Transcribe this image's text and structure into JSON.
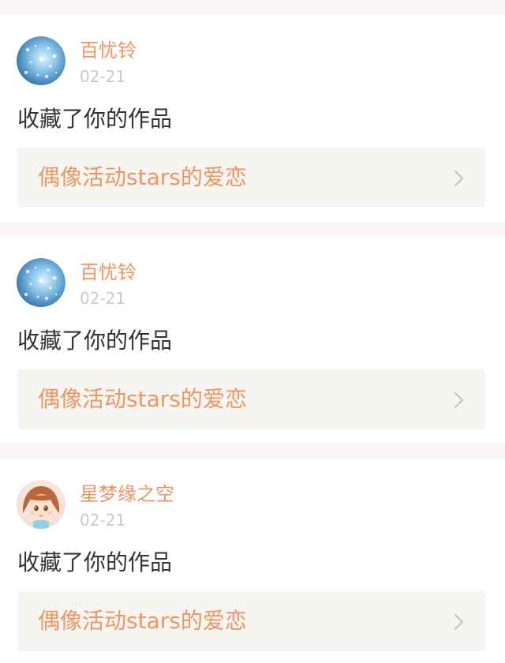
{
  "notifications": [
    {
      "avatar_icon": "blue-glitter-avatar",
      "user_name": "百忧铃",
      "timestamp": "02-21",
      "action": "收藏了你的作品",
      "work_title": "偶像活动stars的爱恋",
      "chevron_icon": "chevron-right-icon"
    },
    {
      "avatar_icon": "blue-glitter-avatar",
      "user_name": "百忧铃",
      "timestamp": "02-21",
      "action": "收藏了你的作品",
      "work_title": "偶像活动stars的爱恋",
      "chevron_icon": "chevron-right-icon"
    },
    {
      "avatar_icon": "anime-girl-avatar",
      "user_name": "星梦缘之空",
      "timestamp": "02-21",
      "action": "收藏了你的作品",
      "work_title": "偶像活动stars的爱恋",
      "chevron_icon": "chevron-right-icon"
    }
  ],
  "colors": {
    "page_background": "#ffffff",
    "divider": "#fbf6f6",
    "user_name": "#ee9460",
    "timestamp": "#c9c9c9",
    "action_text": "#333333",
    "work_card_background": "#f6f5f1",
    "work_title": "#ef9562",
    "chevron": "#c4c4c4"
  }
}
